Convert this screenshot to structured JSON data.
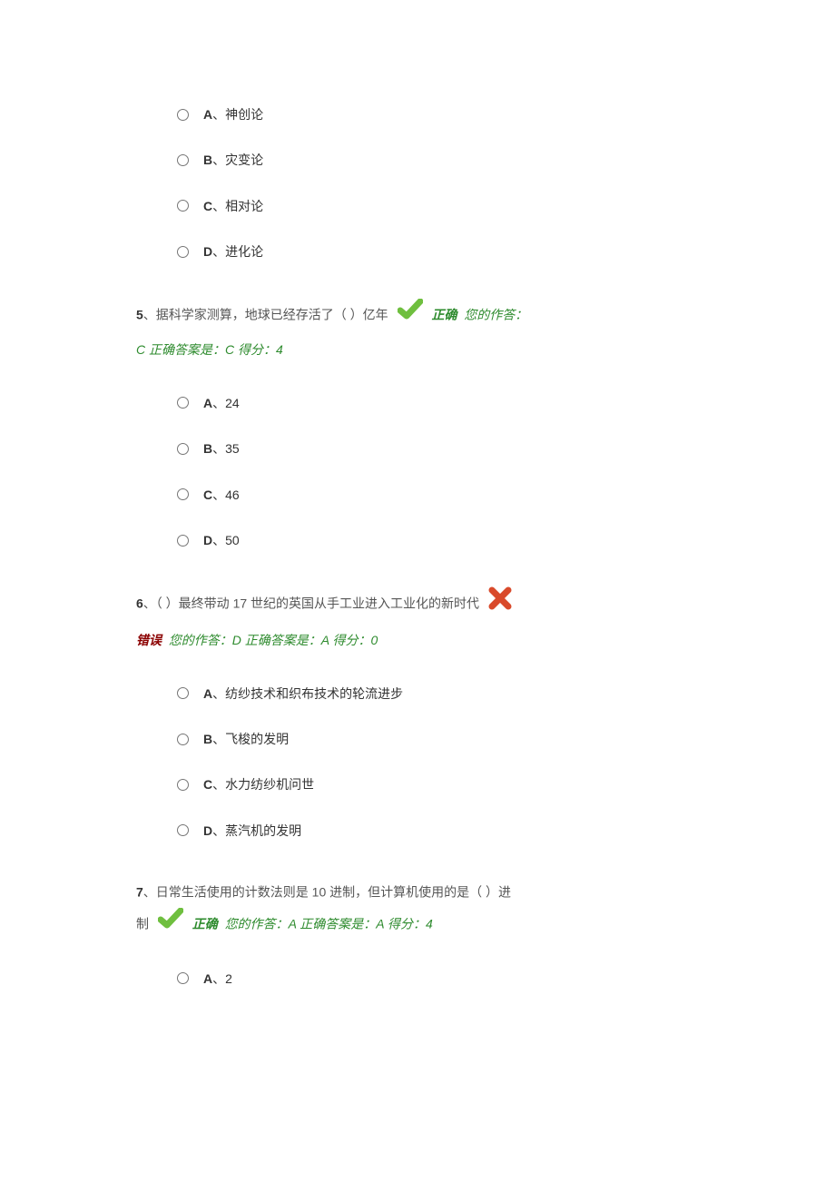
{
  "q4": {
    "options": [
      {
        "letter": "A",
        "text": "、神创论"
      },
      {
        "letter": "B",
        "text": "、灾变论"
      },
      {
        "letter": "C",
        "text": "、相对论"
      },
      {
        "letter": "D",
        "text": "、进化论"
      }
    ]
  },
  "q5": {
    "num": "5",
    "stem": "、据科学家测算，地球已经存活了（ ）亿年",
    "status": "正确",
    "feedback_prefix": "您的作答：",
    "feedback": "C  正确答案是：C  得分：4",
    "options": [
      {
        "letter": "A",
        "text": "、24"
      },
      {
        "letter": "B",
        "text": "、35"
      },
      {
        "letter": "C",
        "text": "、46"
      },
      {
        "letter": "D",
        "text": "、50"
      }
    ]
  },
  "q6": {
    "num": "6",
    "stem": "、（ ）最终带动 17 世纪的英国从手工业进入工业化的新时代",
    "status": "错误",
    "feedback_prefix": "您的作答：",
    "feedback": "D  正确答案是：A  得分：0",
    "options": [
      {
        "letter": "A",
        "text": "、纺纱技术和织布技术的轮流进步"
      },
      {
        "letter": "B",
        "text": "、飞梭的发明"
      },
      {
        "letter": "C",
        "text": "、水力纺纱机问世"
      },
      {
        "letter": "D",
        "text": "、蒸汽机的发明"
      }
    ]
  },
  "q7": {
    "num": "7",
    "stem_part1": "、日常生活使用的计数法则是 10 进制，但计算机使用的是（ ）进",
    "stem_part2": "制",
    "status": "正确",
    "feedback_prefix": "您的作答：",
    "feedback": "A  正确答案是：A  得分：4",
    "options": [
      {
        "letter": "A",
        "text": "、2"
      }
    ]
  }
}
